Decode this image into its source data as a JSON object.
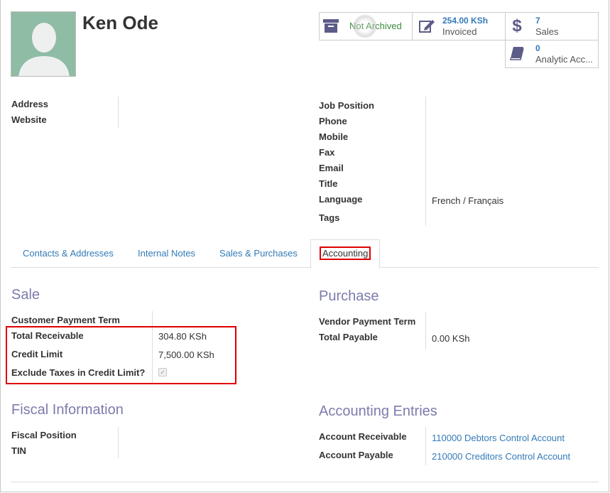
{
  "partner": {
    "name": "Ken Ode"
  },
  "stats": {
    "archive_label": "Not Archived",
    "invoiced_value": "254.00 KSh",
    "invoiced_label": "Invoiced",
    "sales_count": "7",
    "sales_label": "Sales",
    "analytic_count": "0",
    "analytic_label": "Analytic Acc..."
  },
  "fields_left": {
    "address": "Address",
    "website": "Website"
  },
  "fields_right": {
    "job_position": "Job Position",
    "phone": "Phone",
    "mobile": "Mobile",
    "fax": "Fax",
    "email": "Email",
    "title": "Title",
    "language": "Language",
    "language_value": "French / Français",
    "tags": "Tags"
  },
  "tabs": [
    "Contacts & Addresses",
    "Internal Notes",
    "Sales & Purchases",
    "Accounting"
  ],
  "sale": {
    "heading": "Sale",
    "payment_term": "Customer Payment Term",
    "total_receivable": "Total Receivable",
    "total_receivable_value": "304.80 KSh",
    "credit_limit": "Credit Limit",
    "credit_limit_value": "7,500.00 KSh",
    "exclude_taxes": "Exclude Taxes in Credit Limit?",
    "exclude_taxes_checked": true
  },
  "purchase": {
    "heading": "Purchase",
    "payment_term": "Vendor Payment Term",
    "total_payable": "Total Payable",
    "total_payable_value": "0.00 KSh"
  },
  "fiscal": {
    "heading": "Fiscal Information",
    "position": "Fiscal Position",
    "tin": "TIN"
  },
  "entries": {
    "heading": "Accounting Entries",
    "receivable": "Account Receivable",
    "receivable_value": "110000 Debtors Control Account",
    "payable": "Account Payable",
    "payable_value": "210000 Creditors Control Account"
  },
  "colors": {
    "link": "#337ab7",
    "section": "#7c7bad",
    "highlight": "#e00000",
    "avatar_bg": "#8fbca4"
  }
}
